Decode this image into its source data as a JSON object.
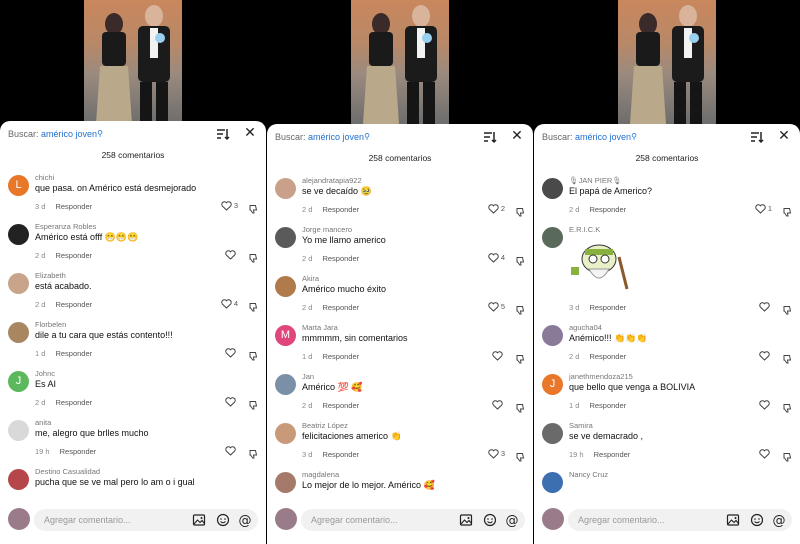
{
  "panels": [
    {
      "search_label": "Buscar:",
      "search_query": "américo joven",
      "comment_count": "258 comentarios",
      "add_comment_placeholder": "Agregar comentario...",
      "comments": [
        {
          "user": "chichi",
          "text": "que pasa. on Américo está desmejorado",
          "time": "3 d",
          "reply": "Responder",
          "likes": "3",
          "avatar_letter": "L",
          "avatar_color": "#e8772a"
        },
        {
          "user": "Esperanza Robles",
          "text": "Américo está offf 😁😁😁",
          "time": "2 d",
          "reply": "Responder",
          "likes": "",
          "avatar_color": "#222222"
        },
        {
          "user": "Elizabeth",
          "text": "está acabado.",
          "time": "2 d",
          "reply": "Responder",
          "likes": "4",
          "avatar_color": "#c8a58a"
        },
        {
          "user": "Florbelen",
          "text": "dile a tu cara que estás contento!!!",
          "time": "1 d",
          "reply": "Responder",
          "likes": "",
          "avatar_color": "#a88760"
        },
        {
          "user": "Johnc",
          "text": "Es AI",
          "time": "2 d",
          "reply": "Responder",
          "likes": "",
          "avatar_letter": "J",
          "avatar_color": "#5cb85c"
        },
        {
          "user": "anita",
          "text": "me, alegro que brlles mucho",
          "time": "19 h",
          "reply": "Responder",
          "likes": "",
          "avatar_color": "#d9d9d9"
        },
        {
          "user": "Destino Casualidad",
          "text": "pucha que se ve mal pero lo am o i gual",
          "time": "",
          "reply": "",
          "likes": "",
          "avatar_color": "#b5474a"
        }
      ]
    },
    {
      "search_label": "Buscar:",
      "search_query": "américo joven",
      "comment_count": "258 comentarios",
      "add_comment_placeholder": "Agregar comentario...",
      "comments": [
        {
          "user": "alejandratapia922",
          "text": "se ve decaído 🥹",
          "time": "2 d",
          "reply": "Responder",
          "likes": "2",
          "avatar_color": "#c9a08a"
        },
        {
          "user": "Jorge mancero",
          "text": "Yo me llamo americo",
          "time": "2 d",
          "reply": "Responder",
          "likes": "4",
          "avatar_color": "#5a5a5a"
        },
        {
          "user": "Akira",
          "text": "Américo mucho éxito",
          "time": "2 d",
          "reply": "Responder",
          "likes": "5",
          "avatar_color": "#b07a4a"
        },
        {
          "user": "Marta Jara",
          "text": "mmmmm, sin comentarios",
          "time": "1 d",
          "reply": "Responder",
          "likes": "",
          "avatar_letter": "M",
          "avatar_color": "#e0457b"
        },
        {
          "user": "Jan",
          "text": "Américo 💯 🥰",
          "time": "2 d",
          "reply": "Responder",
          "likes": "",
          "avatar_color": "#7b8fa6"
        },
        {
          "user": "Beatriz López",
          "text": "felicitaciones americo 👏",
          "time": "3 d",
          "reply": "Responder",
          "likes": "3",
          "avatar_color": "#c89a7a"
        },
        {
          "user": "magdalena",
          "text": "Lo mejor de lo mejor. Américo 🥰",
          "time": "",
          "reply": "",
          "likes": "",
          "avatar_color": "#a57a6a"
        }
      ]
    },
    {
      "search_label": "Buscar:",
      "search_query": "américo joven",
      "comment_count": "258 comentarios",
      "add_comment_placeholder": "Agregar comentario...",
      "comments": [
        {
          "user": "🎙JAN PIER🎙",
          "text": "El papá de Americo?",
          "time": "2 d",
          "reply": "Responder",
          "likes": "1",
          "avatar_color": "#4a4a4a"
        },
        {
          "user": "E.R.I.C.K",
          "text": "",
          "time": "3 d",
          "reply": "Responder",
          "likes": "",
          "avatar_color": "#5a6a5a",
          "sticker": true
        },
        {
          "user": "agucha04",
          "text": "Anémico!!! 👏👏👏",
          "time": "2 d",
          "reply": "Responder",
          "likes": "",
          "avatar_color": "#8a7a9a"
        },
        {
          "user": "janethmendoza215",
          "text": "que bello que venga a BOLIVIA",
          "time": "1 d",
          "reply": "Responder",
          "likes": "",
          "avatar_letter": "J",
          "avatar_color": "#e8772a"
        },
        {
          "user": "Samira",
          "text": "se ve demacrado ,",
          "time": "19 h",
          "reply": "Responder",
          "likes": "",
          "avatar_color": "#6a6a6a"
        },
        {
          "user": "Nancy Cruz",
          "text": "",
          "time": "",
          "reply": "",
          "likes": "",
          "avatar_color": "#3b6fb0"
        }
      ]
    }
  ]
}
